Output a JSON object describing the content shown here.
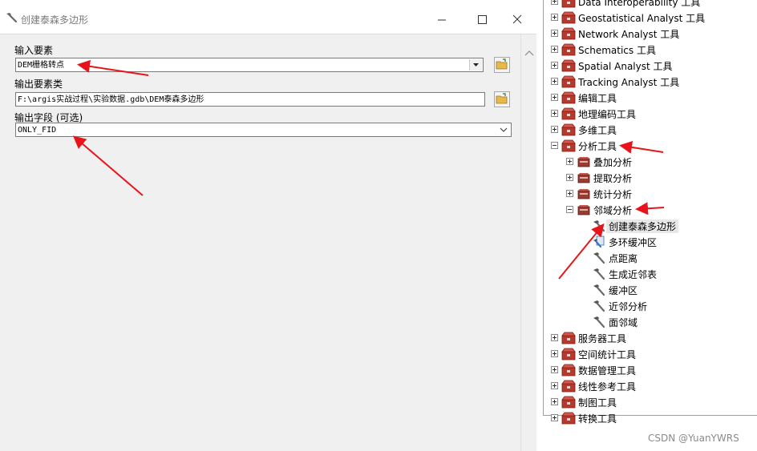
{
  "dialog": {
    "title": "创建泰森多边形",
    "input_features_label": "输入要素",
    "input_features_value": "DEM栅格转点",
    "output_fc_label": "输出要素类",
    "output_fc_value": "F:\\argis实战过程\\实验数据.gdb\\DEM泰森多边形",
    "output_fields_label": "输出字段 (可选)",
    "output_fields_value": "ONLY_FID"
  },
  "tree": {
    "items": [
      {
        "label": "Data Interoperability 工具",
        "expander": "plus",
        "icon": "toolbox-icon"
      },
      {
        "label": "Geostatistical Analyst 工具",
        "expander": "plus",
        "icon": "toolbox-icon"
      },
      {
        "label": "Network Analyst 工具",
        "expander": "plus",
        "icon": "toolbox-icon"
      },
      {
        "label": "Schematics 工具",
        "expander": "plus",
        "icon": "toolbox-icon"
      },
      {
        "label": "Spatial Analyst 工具",
        "expander": "plus",
        "icon": "toolbox-icon"
      },
      {
        "label": "Tracking Analyst 工具",
        "expander": "plus",
        "icon": "toolbox-icon"
      },
      {
        "label": "编辑工具",
        "expander": "plus",
        "icon": "toolbox-icon"
      },
      {
        "label": "地理编码工具",
        "expander": "plus",
        "icon": "toolbox-icon"
      },
      {
        "label": "多维工具",
        "expander": "plus",
        "icon": "toolbox-icon"
      },
      {
        "label": "分析工具",
        "expander": "minus",
        "icon": "toolbox-icon"
      },
      {
        "label": "叠加分析",
        "expander": "plus",
        "icon": "toolset-icon"
      },
      {
        "label": "提取分析",
        "expander": "plus",
        "icon": "toolset-icon"
      },
      {
        "label": "统计分析",
        "expander": "plus",
        "icon": "toolset-icon"
      },
      {
        "label": "邻域分析",
        "expander": "minus",
        "icon": "toolset-icon"
      },
      {
        "label": "创建泰森多边形",
        "icon": "hammer-tool-icon",
        "selected": true
      },
      {
        "label": "多环缓冲区",
        "icon": "script-tool-icon"
      },
      {
        "label": "点距离",
        "icon": "hammer-tool-icon"
      },
      {
        "label": "生成近邻表",
        "icon": "hammer-tool-icon"
      },
      {
        "label": "缓冲区",
        "icon": "hammer-tool-icon"
      },
      {
        "label": "近邻分析",
        "icon": "hammer-tool-icon"
      },
      {
        "label": "面邻域",
        "icon": "hammer-tool-icon"
      },
      {
        "label": "服务器工具",
        "expander": "plus",
        "icon": "toolbox-icon"
      },
      {
        "label": "空间统计工具",
        "expander": "plus",
        "icon": "toolbox-icon"
      },
      {
        "label": "数据管理工具",
        "expander": "plus",
        "icon": "toolbox-icon"
      },
      {
        "label": "线性参考工具",
        "expander": "plus",
        "icon": "toolbox-icon"
      },
      {
        "label": "制图工具",
        "expander": "plus",
        "icon": "toolbox-icon"
      },
      {
        "label": "转换工具",
        "expander": "plus",
        "icon": "toolbox-icon"
      }
    ]
  },
  "watermark": "CSDN @YuanYWRS",
  "colors": {
    "annotation_arrow": "#e8141b",
    "toolbox": "#b5392c"
  }
}
